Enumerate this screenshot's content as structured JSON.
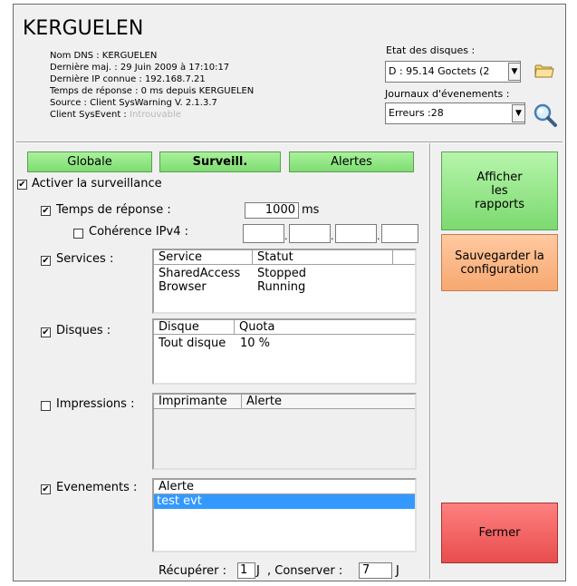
{
  "header": {
    "title": "KERGUELEN",
    "info": [
      "Nom DNS : KERGUELEN",
      "Dernière maj. : 29 Juin 2009 à 17:10:17",
      "Dernière IP connue : 192.168.7.21",
      "Temps de réponse : 0 ms depuis KERGUELEN",
      "Source : Client SysWarning V. 2.1.3.7"
    ],
    "client_sysevent_label": "Client SysEvent :",
    "client_sysevent_value": "Introuvable"
  },
  "disques": {
    "label": "Etat des disques :",
    "selected": "D : 95.14 Goctets (2"
  },
  "journaux": {
    "label": "Journaux d'évenements :",
    "selected": "Erreurs :28"
  },
  "tabs": [
    {
      "label": "Globale",
      "active": false
    },
    {
      "label": "Surveill.",
      "active": true
    },
    {
      "label": "Alertes",
      "active": false
    }
  ],
  "surveillance": {
    "activer_label": "Activer la surveillance",
    "activer_checked": true,
    "temps_label": "Temps de réponse :",
    "temps_checked": true,
    "temps_value": "1000",
    "temps_unit": "ms",
    "ipv4_label": "Cohérence IPv4 :",
    "ipv4_checked": false,
    "ipv4_values": [
      "",
      "",
      "",
      ""
    ]
  },
  "services": {
    "label": "Services :",
    "checked": true,
    "columns": [
      "Service",
      "Statut"
    ],
    "rows": [
      [
        "SharedAccess",
        "Stopped"
      ],
      [
        "Browser",
        "Running"
      ]
    ]
  },
  "disques_list": {
    "label": "Disques :",
    "checked": true,
    "columns": [
      "Disque",
      "Quota"
    ],
    "rows": [
      [
        "Tout disque",
        "10 %"
      ]
    ]
  },
  "impressions": {
    "label": "Impressions :",
    "checked": false,
    "columns": [
      "Imprimante",
      "Alerte"
    ],
    "rows": []
  },
  "evenements": {
    "label": "Evenements :",
    "checked": true,
    "columns": [
      "Alerte"
    ],
    "rows": [
      "test evt"
    ]
  },
  "retention": {
    "recuperer_label": "Récupérer :",
    "recuperer_value": "1",
    "unit_j": "J",
    "conserver_label": ", Conserver :",
    "conserver_value": "7"
  },
  "buttons": {
    "afficher": "Afficher les rapports",
    "sauvegarder": "Sauvegarder la configuration",
    "fermer": "Fermer"
  },
  "icons": {
    "folder": "folder-icon",
    "search": "magnifier-icon",
    "dropdown": "chevron-down-icon"
  },
  "colors": {
    "tab_green": "#7fdb72",
    "button_orange": "#f7a870",
    "button_red": "#e84d4d",
    "selection": "#3399ff"
  }
}
